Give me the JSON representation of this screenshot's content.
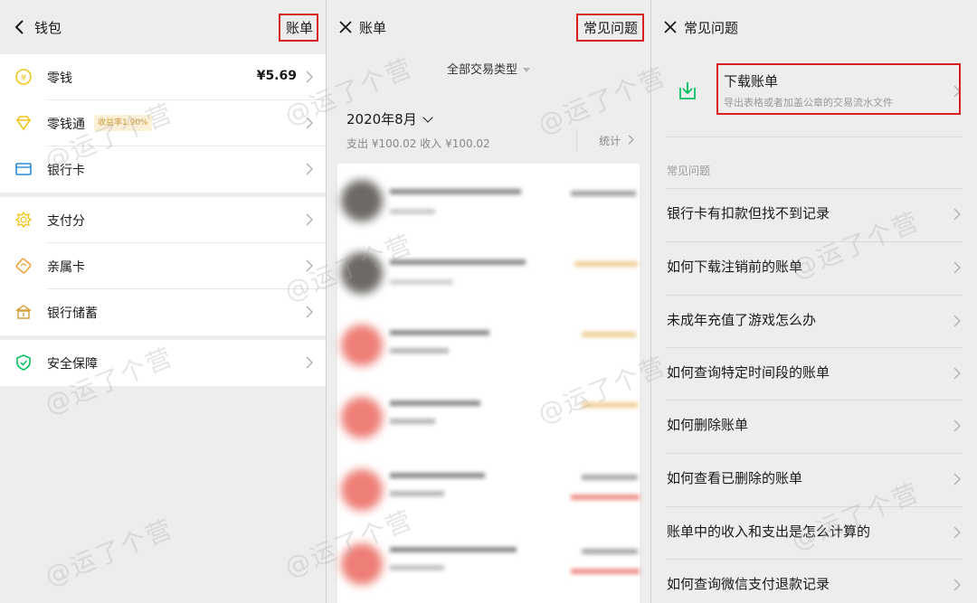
{
  "wallet": {
    "title": "钱包",
    "bill_link": "账单",
    "items": [
      {
        "label": "零钱",
        "value": "¥5.69",
        "icon": "coin-icon"
      },
      {
        "label": "零钱通",
        "badge": "收益率1.90%",
        "icon": "diamond-icon"
      },
      {
        "label": "银行卡",
        "icon": "bank-card-icon"
      },
      {
        "label": "支付分",
        "icon": "pay-score-icon"
      },
      {
        "label": "亲属卡",
        "icon": "family-card-icon"
      },
      {
        "label": "银行储蓄",
        "icon": "savings-icon"
      },
      {
        "label": "安全保障",
        "icon": "shield-icon"
      }
    ]
  },
  "bill": {
    "title": "账单",
    "faq_link": "常见问题",
    "filter": "全部交易类型",
    "month": "2020年8月",
    "summary": "支出 ¥100.02 收入 ¥100.02",
    "stats": "统计"
  },
  "faq": {
    "title": "常见问题",
    "download_title": "下载账单",
    "download_desc": "导出表格或者加盖公章的交易流水文件",
    "section_label": "常见问题",
    "questions": [
      "银行卡有扣款但找不到记录",
      "如何下载注销前的账单",
      "未成年充值了游戏怎么办",
      "如何查询特定时间段的账单",
      "如何删除账单",
      "如何查看已删除的账单",
      "账单中的收入和支出是怎么计算的",
      "如何查询微信支付退款记录"
    ]
  },
  "watermark": "@运了个营",
  "colors": {
    "accent_green": "#07c160",
    "highlight_red": "#d81f1f",
    "coin_yellow": "#f0c419",
    "bank_blue": "#2a8bd8"
  }
}
